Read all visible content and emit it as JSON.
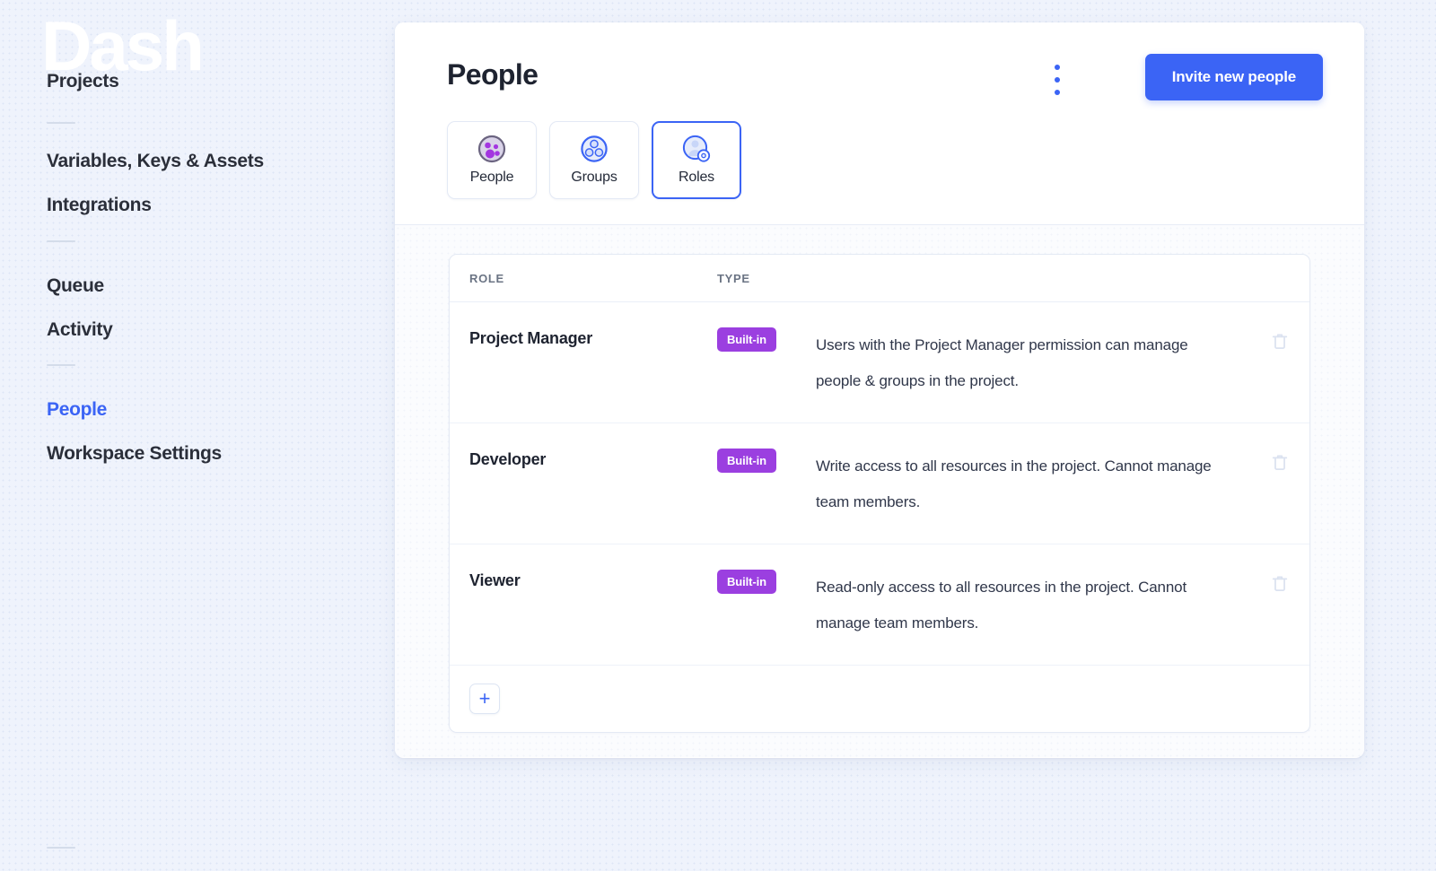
{
  "brand": {
    "watermark": "Dash"
  },
  "sidebar": {
    "items": [
      {
        "label": "Projects",
        "name": "projects",
        "active": false
      },
      {
        "label": "Variables, Keys & Assets",
        "name": "variables",
        "active": false
      },
      {
        "label": "Integrations",
        "name": "integrations",
        "active": false
      },
      {
        "label": "Queue",
        "name": "queue",
        "active": false
      },
      {
        "label": "Activity",
        "name": "activity",
        "active": false
      },
      {
        "label": "People",
        "name": "people",
        "active": true
      },
      {
        "label": "Workspace Settings",
        "name": "workspace",
        "active": false
      }
    ]
  },
  "header": {
    "title": "People",
    "invite_label": "Invite new people",
    "kebab_icon": "more-vertical-icon"
  },
  "tabs": [
    {
      "label": "People",
      "icon": "people-circle-icon",
      "selected": false
    },
    {
      "label": "Groups",
      "icon": "groups-circle-icon",
      "selected": false
    },
    {
      "label": "Roles",
      "icon": "role-gear-icon",
      "selected": true
    }
  ],
  "table": {
    "columns": [
      "ROLE",
      "TYPE"
    ],
    "rows": [
      {
        "role": "Project Manager",
        "type": "Built-in",
        "description": "Users with the Project Manager permission can manage people & groups in the project.",
        "delete_icon": "trash-icon"
      },
      {
        "role": "Developer",
        "type": "Built-in",
        "description": "Write access to all resources in the project. Cannot manage team members.",
        "delete_icon": "trash-icon"
      },
      {
        "role": "Viewer",
        "type": "Built-in",
        "description": "Read-only access to all resources in the project. Cannot manage team members.",
        "delete_icon": "trash-icon"
      }
    ],
    "add_label": "+"
  },
  "colors": {
    "accent": "#3b64f5",
    "badge": "#9b3fe0",
    "page_bg": "#eff3fc",
    "card_bg": "#ffffff",
    "text": "#1e2330"
  }
}
